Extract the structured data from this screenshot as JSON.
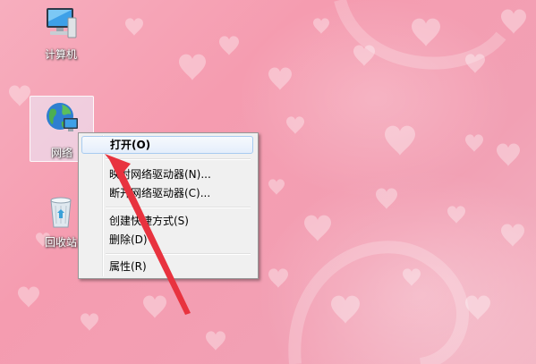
{
  "desktop": {
    "icons": [
      {
        "label": "计算机",
        "icon": "computer-icon"
      },
      {
        "label": "网络",
        "icon": "network-globe-icon"
      },
      {
        "label": "回收站",
        "icon": "recycle-bin-icon"
      }
    ]
  },
  "context_menu": {
    "items": [
      {
        "label": "打开(O)"
      },
      {
        "label": "映射网络驱动器(N)..."
      },
      {
        "label": "断开网络驱动器(C)..."
      },
      {
        "label": "创建快捷方式(S)"
      },
      {
        "label": "删除(D)"
      },
      {
        "label": "属性(R)"
      }
    ]
  },
  "colors": {
    "wallpaper": "#f59cb0",
    "annotation_arrow": "#e8333f",
    "menu_highlight": "#e5eefb"
  }
}
